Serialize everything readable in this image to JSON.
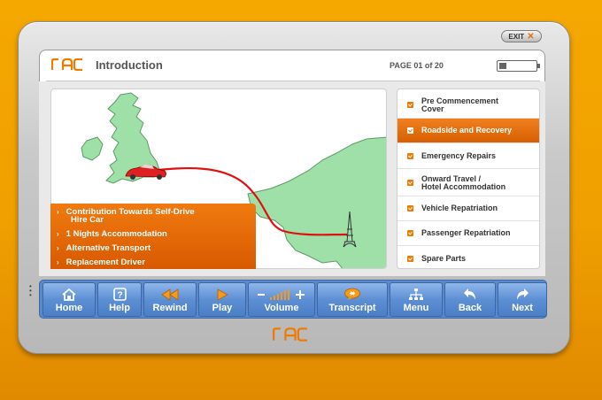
{
  "brand": {
    "logo_text": "RAC",
    "accent": "#f07a00",
    "toolbar_blue": "#5a88c8"
  },
  "exit_label": "EXIT",
  "header": {
    "title": "Introduction",
    "page_count": "PAGE 01 of 20",
    "battery_level": 0.2
  },
  "features": [
    "Contribution Towards Self-Drive",
    "Hire Car",
    "1 Nights Accommodation",
    "Alternative Transport",
    "Replacement Driver"
  ],
  "menu": [
    "Pre Commencement",
    "Cover",
    "Roadside and Recovery",
    "Emergency Repairs",
    "Onward Travel /",
    "Hotel Accommodation",
    "Vehicle Repatriation",
    "Passenger Repatriation",
    "Spare Parts"
  ],
  "menu_active": "Roadside and Recovery",
  "toolbar": [
    {
      "label": "Home",
      "icon": "home-icon"
    },
    {
      "label": "Help",
      "icon": "help-icon"
    },
    {
      "label": "Rewind",
      "icon": "rewind-icon"
    },
    {
      "label": "Play",
      "icon": "play-icon"
    },
    {
      "label": "Volume",
      "icon": "volume-icon"
    },
    {
      "label": "Transcript",
      "icon": "transcript-icon"
    },
    {
      "label": "Menu",
      "icon": "menu-tree-icon"
    },
    {
      "label": "Back",
      "icon": "back-arrow-icon"
    },
    {
      "label": "Next",
      "icon": "next-arrow-icon"
    }
  ]
}
